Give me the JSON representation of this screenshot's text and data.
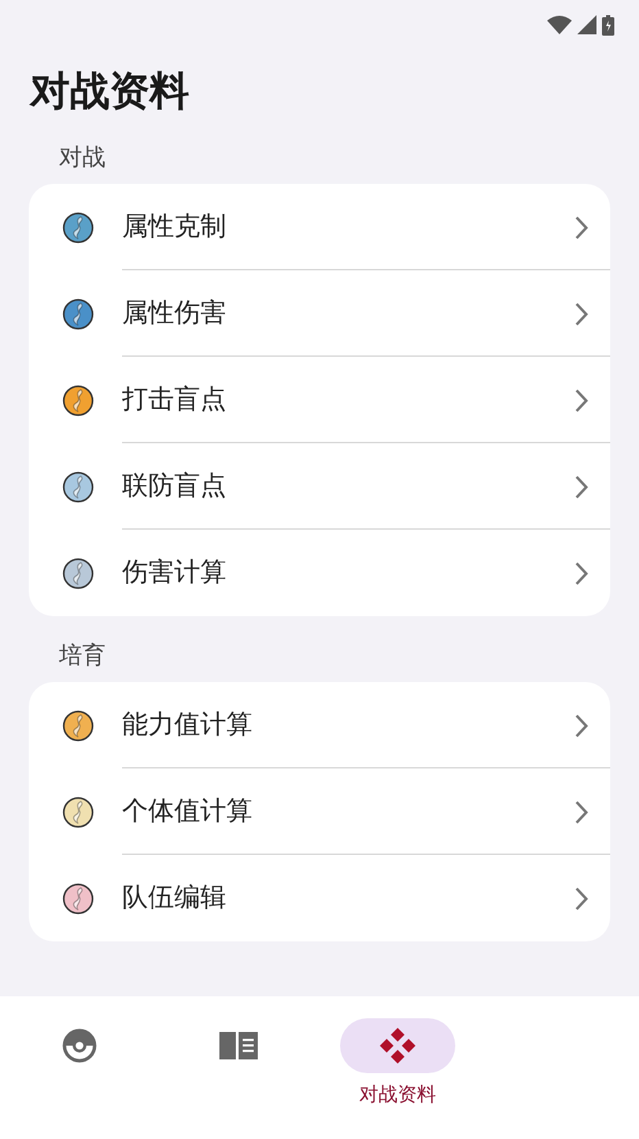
{
  "title": "对战资料",
  "sections": [
    {
      "label": "对战",
      "items": [
        {
          "label": "属性克制",
          "color": "#5aa0c8"
        },
        {
          "label": "属性伤害",
          "color": "#4a90c8"
        },
        {
          "label": "打击盲点",
          "color": "#f0a030"
        },
        {
          "label": "联防盲点",
          "color": "#a8c8e0"
        },
        {
          "label": "伤害计算",
          "color": "#b8c8d8"
        }
      ]
    },
    {
      "label": "培育",
      "items": [
        {
          "label": "能力值计算",
          "color": "#f0b050"
        },
        {
          "label": "个体值计算",
          "color": "#f0e0b0"
        },
        {
          "label": "队伍编辑",
          "color": "#f0c0c8"
        }
      ]
    }
  ],
  "nav": [
    {
      "kind": "ball",
      "selected": false
    },
    {
      "kind": "book",
      "selected": false
    },
    {
      "kind": "dpad",
      "selected": true,
      "label": "对战资料"
    }
  ]
}
